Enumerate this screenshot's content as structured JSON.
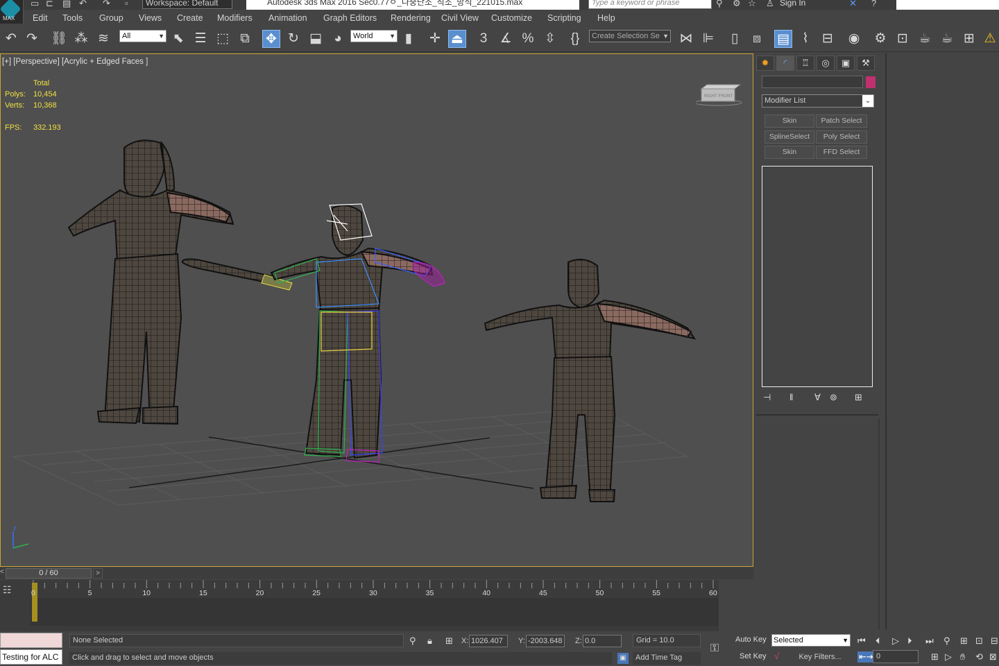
{
  "title_bar": {
    "logo_text": "MAX",
    "workspace": "Workspace: Default",
    "document_title": "Autodesk 3ds Max 2016    Sec0.77ㅇ_다중단조_직조_방식_221015.max",
    "search_placeholder": "Type a keyword or phrase",
    "sign_in": "Sign In"
  },
  "menu": {
    "items": [
      "Edit",
      "Tools",
      "Group",
      "Views",
      "Create",
      "Modifiers",
      "Animation",
      "Graph Editors",
      "Rendering",
      "Civil View",
      "Customize",
      "Scripting",
      "Help"
    ]
  },
  "toolbar": {
    "selection_filter": "All",
    "ref_coord": "World",
    "named_selection": "Create Selection Se",
    "snap_label": "3"
  },
  "viewport": {
    "label": "[+] [Perspective] [Acrylic + Edged Faces ]",
    "stats": {
      "header": "Total",
      "polys_label": "Polys:",
      "polys_value": "10,454",
      "verts_label": "Verts:",
      "verts_value": "10,368",
      "fps_label": "FPS:",
      "fps_value": "332.193"
    },
    "axis_label": "z",
    "viewcube_label": "RIGHT FRONT"
  },
  "command_panel": {
    "modifier_list": "Modifier List",
    "modifier_buttons": [
      "Skin",
      "Patch Select",
      "SplineSelect",
      "Poly Select",
      "Skin",
      "FFD Select"
    ],
    "color_hex": "#c0306e"
  },
  "timeline": {
    "slider_text": "0 / 60",
    "prev": "<",
    "next": ">",
    "tick_labels": [
      "0",
      "5",
      "10",
      "15",
      "20",
      "25",
      "30",
      "35",
      "40",
      "45",
      "50",
      "55",
      "60"
    ]
  },
  "status": {
    "listener_text": "Testing for ALC",
    "selection": "None Selected",
    "prompt": "Click and drag to select and move objects",
    "x_label": "X:",
    "x_value": "1026.407",
    "y_label": "Y:",
    "y_value": "-2003.648",
    "z_label": "Z:",
    "z_value": "0.0",
    "grid": "Grid = 10.0",
    "add_time_tag": "Add Time Tag",
    "auto_key": "Auto Key",
    "set_key": "Set Key",
    "key_mode": "Selected",
    "key_filters": "Key Filters...",
    "current_frame": "0"
  }
}
